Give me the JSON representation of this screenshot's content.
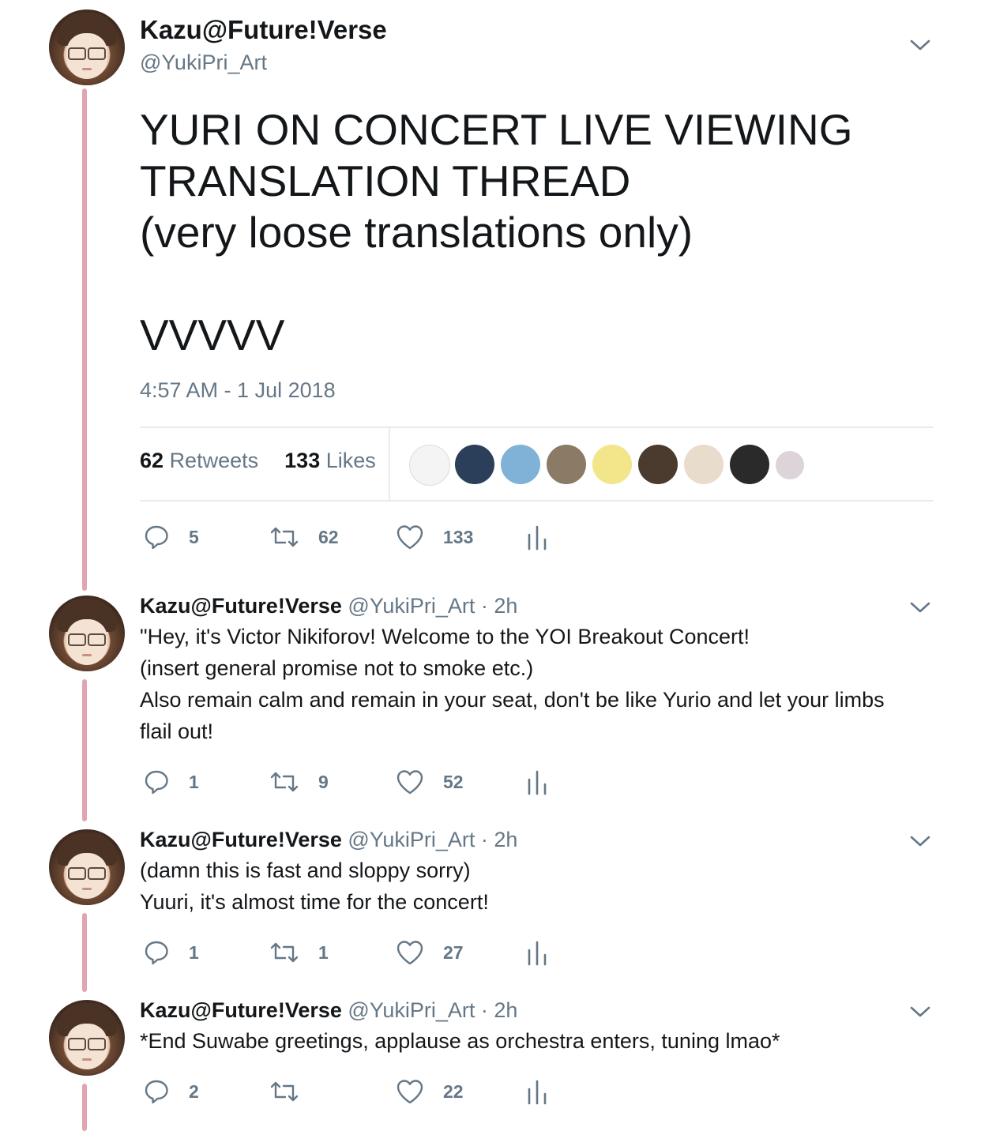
{
  "main_tweet": {
    "name": "Kazu@Future!Verse",
    "handle": "@YukiPri_Art",
    "text": "YURI ON CONCERT LIVE VIEWING\nTRANSLATION THREAD\n(very loose translations only)\n\nVVVVV",
    "timestamp": "4:57 AM - 1 Jul 2018",
    "retweets_count": "62",
    "retweets_label": "Retweets",
    "likes_count": "133",
    "likes_label": "Likes",
    "actions": {
      "replies": "5",
      "retweets": "62",
      "likes": "133"
    }
  },
  "liker_colors": [
    "#f4f4f4",
    "#2b3f5a",
    "#7fb2d6",
    "#8a7a66",
    "#f2e58a",
    "#4b3a2e",
    "#e8dccd",
    "#2a2a2a",
    "#dcd4d8"
  ],
  "replies": [
    {
      "name": "Kazu@Future!Verse",
      "handle": "@YukiPri_Art",
      "time": "· 2h",
      "text": "\"Hey, it's Victor Nikiforov! Welcome to the YOI Breakout Concert!\n(insert general promise not to smoke etc.)\nAlso remain calm and remain in your seat, don't be like Yurio and let your limbs\nflail out!",
      "actions": {
        "replies": "1",
        "retweets": "9",
        "likes": "52"
      }
    },
    {
      "name": "Kazu@Future!Verse",
      "handle": "@YukiPri_Art",
      "time": "· 2h",
      "text": "(damn this is fast and sloppy sorry)\nYuuri, it's almost time for the concert!",
      "actions": {
        "replies": "1",
        "retweets": "1",
        "likes": "27"
      }
    },
    {
      "name": "Kazu@Future!Verse",
      "handle": "@YukiPri_Art",
      "time": "· 2h",
      "text": "*End Suwabe greetings, applause as orchestra enters, tuning lmao*",
      "actions": {
        "replies": "2",
        "retweets": "",
        "likes": "22"
      }
    }
  ],
  "colors": {
    "thread_line": "#e1a5b2",
    "secondary_text": "#657786",
    "divider": "#e6ecf0"
  }
}
